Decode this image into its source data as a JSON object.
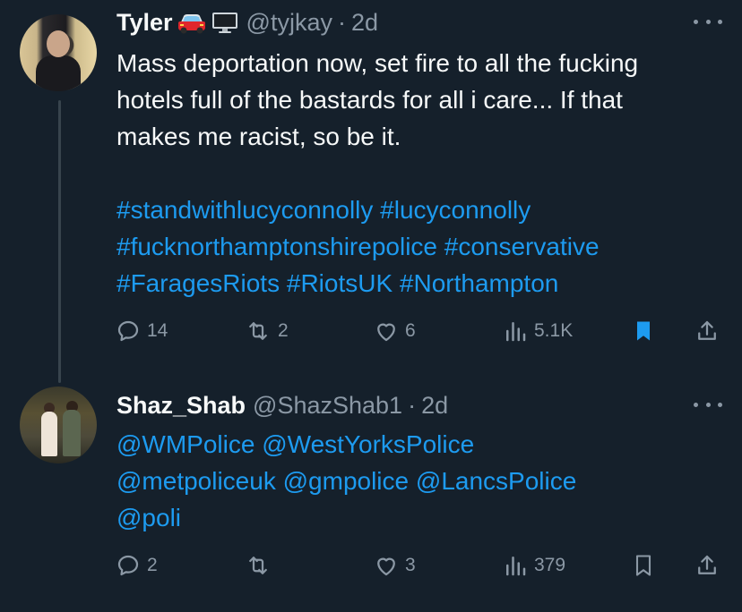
{
  "tweets": [
    {
      "name": "Tyler",
      "emojis": [
        "car-emoji",
        "computer-emoji"
      ],
      "handle": "@tyjkay",
      "separator": "·",
      "time": "2d",
      "text_lines": [
        "Mass deportation now, set fire to all the fucking",
        "hotels full of the bastards for all i care... If that",
        "makes me racist, so be it."
      ],
      "hashtag_lines": [
        [
          "#standwithlucyconnolly",
          "#lucyconnolly"
        ],
        [
          "#fucknorthamptonshirepolice",
          "#conservative"
        ],
        [
          "#FaragesRiots",
          "#RiotsUK",
          "#Northampton"
        ]
      ],
      "stats": {
        "replies": "14",
        "reposts": "2",
        "likes": "6",
        "views": "5.1K"
      },
      "bookmarked": true
    },
    {
      "name": "Shaz_Shab",
      "handle": "@ShazShab1",
      "separator": "·",
      "time": "2d",
      "mention_lines": [
        [
          "@WMPolice",
          "@WestYorksPolice"
        ],
        [
          "@metpoliceuk",
          "@gmpolice",
          "@LancsPolice"
        ],
        [
          "@poli"
        ]
      ],
      "stats": {
        "replies": "2",
        "reposts": "",
        "likes": "3",
        "views": "379"
      },
      "bookmarked": false
    }
  ],
  "colors": {
    "background": "#15202b",
    "text": "#f7f9f9",
    "muted": "#8b98a5",
    "link": "#1d9bf0",
    "thread_line": "#38444d"
  }
}
